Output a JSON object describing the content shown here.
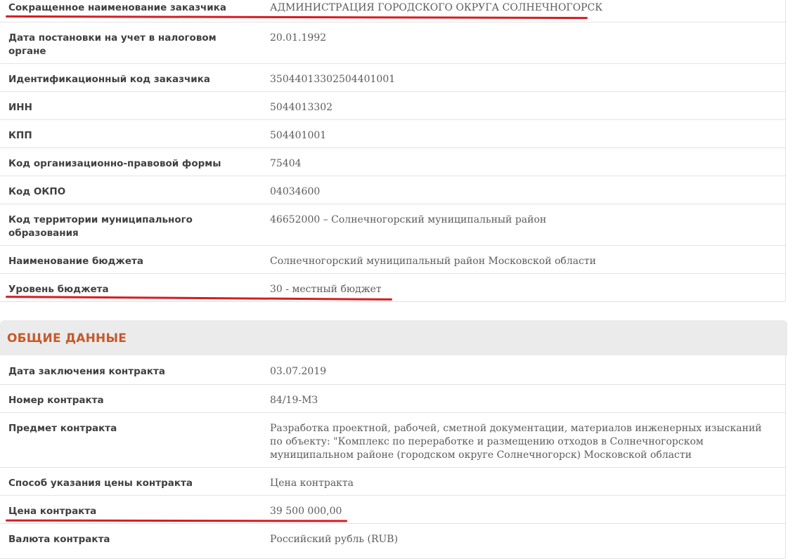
{
  "customer": {
    "rows": [
      {
        "label": "Сокращенное наименование заказчика",
        "value": "АДМИНИСТРАЦИЯ ГОРОДСКОГО ОКРУГА СОЛНЕЧНОГОРСК"
      },
      {
        "label": "Дата постановки на учет в налоговом органе",
        "value": "20.01.1992"
      },
      {
        "label": "Идентификационный код заказчика",
        "value": "350440133025044010​01"
      },
      {
        "label": "ИНН",
        "value": "5044013302"
      },
      {
        "label": "КПП",
        "value": "504401001"
      },
      {
        "label": "Код организационно-правовой формы",
        "value": "75404"
      },
      {
        "label": "Код ОКПО",
        "value": "04034600"
      },
      {
        "label": "Код территории муниципального образования",
        "value": "46652000 – Солнечногорский муниципальный район"
      },
      {
        "label": "Наименование бюджета",
        "value": "Солнечногорский муниципальный район Московской области"
      },
      {
        "label": "Уровень бюджета",
        "value": "30 - местный бюджет"
      }
    ]
  },
  "general": {
    "title": "ОБЩИЕ ДАННЫЕ",
    "rows": [
      {
        "label": "Дата заключения контракта",
        "value": "03.07.2019"
      },
      {
        "label": "Номер контракта",
        "value": "84/19-МЗ"
      },
      {
        "label": "Предмет контракта",
        "value": "Разработка проектной, рабочей, сметной документации, материалов инженерных изысканий по объекту: \"Комплекс по переработке и размещению отходов в Солнечногорском муниципальном районе (городском округе Солнечногорск) Московской области"
      },
      {
        "label": "Способ указания цены контракта",
        "value": "Цена контракта"
      },
      {
        "label": "Цена контракта",
        "value": "39 500 000,00"
      },
      {
        "label": "Валюта контракта",
        "value": "Российский рубль (RUB)"
      }
    ]
  },
  "colors": {
    "accent": "#c45a2b",
    "highlight_mark": "#d51d22",
    "section_bg": "#ebebeb"
  }
}
